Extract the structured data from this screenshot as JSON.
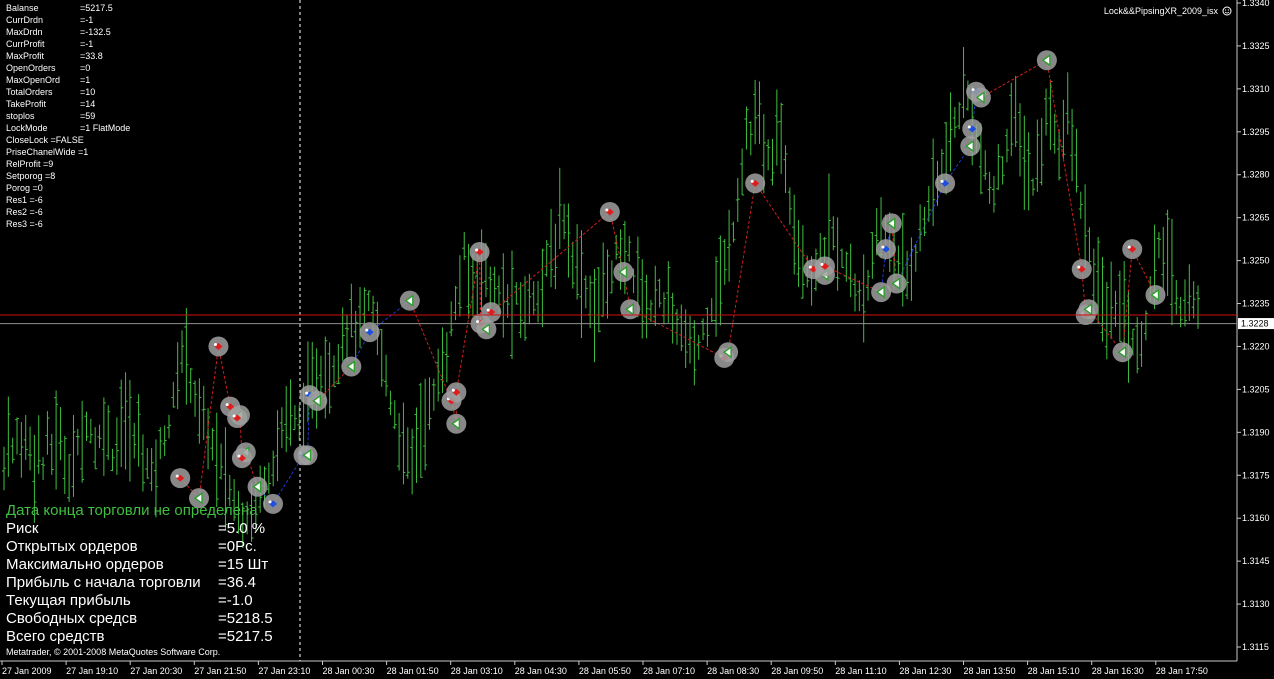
{
  "chart_data": {
    "type": "bar",
    "title": "",
    "indicator_label": "Lock&&PipsingXR_2009_isx",
    "xlabel": "",
    "ylabel": "",
    "ylim": [
      3.1105,
      3.3345
    ],
    "y_ticks": [
      "1.3340",
      "1.3325",
      "1.3310",
      "1.3295",
      "1.3280",
      "1.3265",
      "1.3250",
      "1.3235",
      "1.3220",
      "1.3205",
      "1.3190",
      "1.3175",
      "1.3160",
      "1.3145",
      "1.3130",
      "1.3115"
    ],
    "y_tick_values": [
      1.334,
      1.3325,
      1.331,
      1.3295,
      1.328,
      1.3265,
      1.325,
      1.3235,
      1.322,
      1.3205,
      1.319,
      1.3175,
      1.316,
      1.3145,
      1.313,
      1.3115
    ],
    "x_labels": [
      "27 Jan 2009",
      "27 Jan 19:10",
      "27 Jan 20:30",
      "27 Jan 21:50",
      "27 Jan 23:10",
      "28 Jan 00:30",
      "28 Jan 01:50",
      "28 Jan 03:10",
      "28 Jan 04:30",
      "28 Jan 05:50",
      "28 Jan 07:10",
      "28 Jan 08:30",
      "28 Jan 09:50",
      "28 Jan 11:10",
      "28 Jan 12:30",
      "28 Jan 13:50",
      "28 Jan 15:10",
      "28 Jan 16:30",
      "28 Jan 17:50"
    ],
    "current_price": "1.3228",
    "current_price_value": 1.3228,
    "bid_line_value": 1.3231,
    "bar_count": 276,
    "price_path": [
      1.3178,
      1.319,
      1.3182,
      1.3188,
      1.3183,
      1.319,
      1.3186,
      1.318,
      1.3185,
      1.3178,
      1.3188,
      1.3182,
      1.319,
      1.3185,
      1.318,
      1.3176,
      1.3182,
      1.3185,
      1.319,
      1.3196,
      1.319,
      1.3183,
      1.3188,
      1.3194,
      1.3188,
      1.3182,
      1.3188,
      1.3196,
      1.319,
      1.3192,
      1.3185,
      1.319,
      1.3182,
      1.3178,
      1.3175,
      1.318,
      1.3186,
      1.319,
      1.3196,
      1.3202,
      1.321,
      1.3222,
      1.3216,
      1.3208,
      1.32,
      1.3196,
      1.3193,
      1.3188,
      1.3184,
      1.318,
      1.3176,
      1.3172,
      1.3168,
      1.3165,
      1.3162,
      1.316,
      1.3164,
      1.3163,
      1.3168,
      1.3172,
      1.3175,
      1.3178,
      1.3183,
      1.3186,
      1.3194,
      1.32,
      1.3196,
      1.3191,
      1.3196,
      1.32,
      1.3202,
      1.3205,
      1.321,
      1.3212,
      1.3207,
      1.3212,
      1.3216,
      1.3222,
      1.3226,
      1.323,
      1.3228,
      1.3225,
      1.323,
      1.3234,
      1.3232,
      1.3228,
      1.3222,
      1.3212,
      1.3204,
      1.3198,
      1.3192,
      1.3186,
      1.3182,
      1.318,
      1.3186,
      1.319,
      1.3194,
      1.3198,
      1.3202,
      1.3206,
      1.3212,
      1.3218,
      1.3226,
      1.3232,
      1.324,
      1.3252,
      1.3246,
      1.324,
      1.3246,
      1.325,
      1.3246,
      1.3242,
      1.324,
      1.3236,
      1.3238,
      1.3234,
      1.3236,
      1.3236,
      1.3232,
      1.3234,
      1.3236,
      1.3238,
      1.324,
      1.3244,
      1.3248,
      1.325,
      1.3254,
      1.3262,
      1.3266,
      1.326,
      1.3252,
      1.3248,
      1.3244,
      1.324,
      1.3236,
      1.3233,
      1.3236,
      1.324,
      1.3244,
      1.3248,
      1.3252,
      1.3248,
      1.325,
      1.3254,
      1.3246,
      1.3242,
      1.3238,
      1.3236,
      1.3232,
      1.3238,
      1.324,
      1.3236,
      1.3233,
      1.323,
      1.3228,
      1.3225,
      1.3222,
      1.3219,
      1.3216,
      1.3222,
      1.3226,
      1.3232,
      1.3236,
      1.324,
      1.3244,
      1.3248,
      1.3256,
      1.3264,
      1.3276,
      1.3286,
      1.3298,
      1.3292,
      1.33,
      1.3296,
      1.3288,
      1.3282,
      1.329,
      1.3296,
      1.329,
      1.328,
      1.327,
      1.3262,
      1.3254,
      1.325,
      1.3247,
      1.3245,
      1.3248,
      1.3252,
      1.3258,
      1.3262,
      1.3258,
      1.3252,
      1.3248,
      1.3246,
      1.3242,
      1.324,
      1.3238,
      1.3241,
      1.3246,
      1.3252,
      1.3256,
      1.326,
      1.3258,
      1.3254,
      1.325,
      1.3247,
      1.3244,
      1.3248,
      1.3252,
      1.3256,
      1.3262,
      1.3268,
      1.3274,
      1.3276,
      1.328,
      1.3284,
      1.3288,
      1.3294,
      1.33,
      1.3306,
      1.331,
      1.3304,
      1.3296,
      1.3288,
      1.3282,
      1.3276,
      1.3272,
      1.3276,
      1.3282,
      1.329,
      1.3296,
      1.33,
      1.3294,
      1.3288,
      1.3282,
      1.3276,
      1.328,
      1.3288,
      1.3298,
      1.3304,
      1.3296,
      1.329,
      1.3296,
      1.33,
      1.3294,
      1.3284,
      1.3272,
      1.3262,
      1.3254,
      1.3246,
      1.324,
      1.3236,
      1.3232,
      1.323,
      1.3234,
      1.3238,
      1.3234,
      1.3228,
      1.3222,
      1.3218,
      1.3222,
      1.323,
      1.3238,
      1.3246,
      1.3252,
      1.3254,
      1.325,
      1.3244,
      1.3238,
      1.3234,
      1.3236,
      1.3238,
      1.3236,
      1.3232
    ],
    "trades": [
      {
        "kind": "sell",
        "x": 0.1457,
        "p": 1.3174
      },
      {
        "kind": "close",
        "x": 0.1609,
        "p": 1.3167
      },
      {
        "kind": "sell",
        "x": 0.1766,
        "p": 1.322
      },
      {
        "kind": "sell",
        "x": 0.1861,
        "p": 1.3199
      },
      {
        "kind": "close",
        "x": 0.194,
        "p": 1.3196
      },
      {
        "kind": "sell",
        "x": 0.1917,
        "p": 1.3195
      },
      {
        "kind": "close",
        "x": 0.1987,
        "p": 1.3183
      },
      {
        "kind": "sell",
        "x": 0.1956,
        "p": 1.3181
      },
      {
        "kind": "close",
        "x": 0.2082,
        "p": 1.3171
      },
      {
        "kind": "buy",
        "x": 0.2207,
        "p": 1.3165
      },
      {
        "kind": "buy",
        "x": 0.2454,
        "p": 1.3182
      },
      {
        "kind": "close",
        "x": 0.2486,
        "p": 1.3182
      },
      {
        "kind": "buy",
        "x": 0.2503,
        "p": 1.3203
      },
      {
        "kind": "close",
        "x": 0.2565,
        "p": 1.3201
      },
      {
        "kind": "close",
        "x": 0.284,
        "p": 1.3213
      },
      {
        "kind": "buy",
        "x": 0.2989,
        "p": 1.3225
      },
      {
        "kind": "close",
        "x": 0.3313,
        "p": 1.3236
      },
      {
        "kind": "close",
        "x": 0.3689,
        "p": 1.3193
      },
      {
        "kind": "sell",
        "x": 0.365,
        "p": 1.3201
      },
      {
        "kind": "sell",
        "x": 0.3689,
        "p": 1.3204
      },
      {
        "kind": "sell",
        "x": 0.3885,
        "p": 1.3228
      },
      {
        "kind": "close",
        "x": 0.3932,
        "p": 1.3226
      },
      {
        "kind": "sell",
        "x": 0.3971,
        "p": 1.3232
      },
      {
        "kind": "sell",
        "x": 0.3877,
        "p": 1.3253
      },
      {
        "kind": "sell",
        "x": 0.493,
        "p": 1.3267
      },
      {
        "kind": "close",
        "x": 0.504,
        "p": 1.3246
      },
      {
        "kind": "close",
        "x": 0.5095,
        "p": 1.3233
      },
      {
        "kind": "sell",
        "x": 0.5855,
        "p": 1.3216
      },
      {
        "kind": "close",
        "x": 0.5886,
        "p": 1.3218
      },
      {
        "kind": "sell",
        "x": 0.6105,
        "p": 1.3277
      },
      {
        "kind": "sell",
        "x": 0.6575,
        "p": 1.3247
      },
      {
        "kind": "close",
        "x": 0.6669,
        "p": 1.3245
      },
      {
        "kind": "sell",
        "x": 0.6669,
        "p": 1.3248
      },
      {
        "kind": "close",
        "x": 0.7123,
        "p": 1.3239
      },
      {
        "kind": "buy",
        "x": 0.7162,
        "p": 1.3254
      },
      {
        "kind": "close",
        "x": 0.7209,
        "p": 1.3263
      },
      {
        "kind": "close",
        "x": 0.7248,
        "p": 1.3242
      },
      {
        "kind": "buy",
        "x": 0.764,
        "p": 1.3277
      },
      {
        "kind": "close",
        "x": 0.7844,
        "p": 1.329
      },
      {
        "kind": "buy",
        "x": 0.786,
        "p": 1.3296
      },
      {
        "kind": "buy",
        "x": 0.7891,
        "p": 1.3309
      },
      {
        "kind": "close",
        "x": 0.793,
        "p": 1.3307
      },
      {
        "kind": "close",
        "x": 0.8463,
        "p": 1.332
      },
      {
        "kind": "sell",
        "x": 0.8745,
        "p": 1.3247
      },
      {
        "kind": "sell",
        "x": 0.8777,
        "p": 1.3231
      },
      {
        "kind": "close",
        "x": 0.88,
        "p": 1.3233
      },
      {
        "kind": "sell",
        "x": 0.9153,
        "p": 1.3254
      },
      {
        "kind": "close",
        "x": 0.9075,
        "p": 1.3218
      },
      {
        "kind": "close",
        "x": 0.9341,
        "p": 1.3238
      }
    ]
  },
  "top_stats": [
    {
      "label": "Balanse",
      "value": "=5217.5"
    },
    {
      "label": "CurrDrdn",
      "value": "=-1"
    },
    {
      "label": "MaxDrdn",
      "value": "=-132.5"
    },
    {
      "label": "CurrProfit",
      "value": "=-1"
    },
    {
      "label": "MaxProfit",
      "value": "=33.8"
    },
    {
      "label": "OpenOrders",
      "value": "=0"
    },
    {
      "label": "MaxOpenOrd",
      "value": "=1"
    },
    {
      "label": "TotalOrders",
      "value": "=10"
    },
    {
      "label": "TakeProfit",
      "value": "=14"
    },
    {
      "label": "stoplos",
      "value": "=59"
    },
    {
      "label": "LockMode",
      "value": "=1 FlatMode"
    }
  ],
  "top_stats_extra": [
    "CloseLock =FALSE",
    "PriseChanelWide  =1",
    "RelProfit =9",
    "Setporog =8",
    "Porog =0",
    "Res1 =-6",
    "Res2 =-6",
    "Res3 =-6"
  ],
  "info_panel": {
    "header": "Дата конца торговли не определена",
    "rows": [
      {
        "label": "Риск",
        "value": "=5.0 %"
      },
      {
        "label": "Открытых ордеров",
        "value": "=0Pc."
      },
      {
        "label": "Максимально ордеров",
        "value": "=15 Шт"
      },
      {
        "label": "Прибыль с начала торговли",
        "value": "=36.4"
      },
      {
        "label": "Текущая прибыль",
        "value": "=-1.0"
      },
      {
        "label": "Свободных средсв",
        "value": "=5218.5"
      },
      {
        "label": "Всего средств",
        "value": "=5217.5"
      }
    ]
  },
  "copyright": "Metatrader, © 2001-2008 MetaQuotes Software Corp.",
  "colors": {
    "background": "#000000",
    "candle": "#3fbf3f",
    "axis": "#c8c8c8",
    "bid_line": "#d01010",
    "ask_line": "#909090",
    "price_badge_bg": "#ffffff",
    "price_badge_fg": "#000000",
    "marker_ring": "#a0a0a0",
    "buy_dot": "#1f4fe0",
    "sell_dot": "#e01c1c",
    "close_arrow": "#2e9e2e",
    "buy_link": "#2038d0",
    "sell_link": "#d01c1c"
  }
}
